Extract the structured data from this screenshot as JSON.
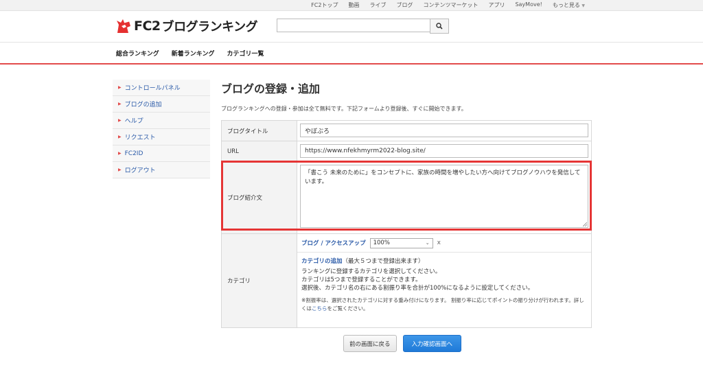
{
  "topnav": [
    "FC2トップ",
    "動画",
    "ライブ",
    "ブログ",
    "コンテンツマーケット",
    "アプリ",
    "SayMove!",
    "もっと見る"
  ],
  "header": {
    "logo_fc2": "FC2",
    "logo_text": "ブログランキング",
    "search_value": ""
  },
  "gnav": [
    "総合ランキング",
    "新着ランキング",
    "カテゴリ一覧"
  ],
  "sidebar": {
    "items": [
      {
        "label": "コントロールパネル"
      },
      {
        "label": "ブログの追加"
      },
      {
        "label": "ヘルプ"
      },
      {
        "label": "リクエスト"
      },
      {
        "label": "FC2ID"
      },
      {
        "label": "ログアウト"
      }
    ]
  },
  "main": {
    "title": "ブログの登録・追加",
    "description": "ブログランキングへの登録・参加は全て無料です。下記フォームより登録後、すぐに開始できます。",
    "form": {
      "blog_title_label": "ブログタイトル",
      "blog_title_value": "やぼぶろ",
      "url_label": "URL",
      "url_value": "https://www.nfekhmyrm2022-blog.site/",
      "intro_label": "ブログ紹介文",
      "intro_value": "「書こう 未来のために」をコンセプトに、家族の時間を増やしたい方へ向けてブログノウハウを発信しています。",
      "category_label": "カテゴリ",
      "category_name": "ブログ / アクセスアップ",
      "category_ratio": "100%",
      "remove": "x",
      "category_add": "カテゴリの追加",
      "category_add_note": "（最大５つまで登録出来ます）",
      "help_line1": "ランキングに登録するカテゴリを選択してください。",
      "help_line2": "カテゴリは5つまで登録することができます。",
      "help_line3": "選択後、カテゴリ名の右にある割振り率を合計が100%になるように設定してください。",
      "note_text": "※割振率は、選択されたカテゴリに対する重み付けになります。 割振り率に応じてポイントの振り分けが行われます。詳しくは",
      "note_link": "こちら",
      "note_end": "をご覧ください。"
    },
    "buttons": {
      "back": "前の画面に戻る",
      "next": "入力確認画面へ"
    }
  },
  "colors": {
    "accent_red": "#e24a4a",
    "link_blue": "#2a5aa8",
    "button_blue": "#1f7ad8",
    "highlight": "#e53535"
  }
}
